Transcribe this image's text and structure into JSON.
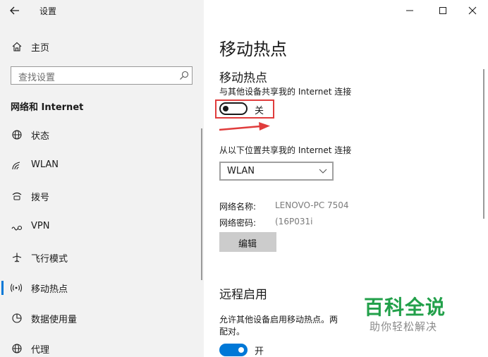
{
  "window": {
    "title": "设置",
    "back_icon": "back-arrow-icon",
    "controls": [
      "minimize-icon",
      "maximize-icon",
      "close-icon"
    ]
  },
  "sidebar": {
    "home_label": "主页",
    "search_placeholder": "查找设置",
    "section_title": "网络和 Internet",
    "items": [
      {
        "label": "状态",
        "icon": "globe-icon"
      },
      {
        "label": "WLAN",
        "icon": "wifi-icon"
      },
      {
        "label": "拨号",
        "icon": "dialup-icon"
      },
      {
        "label": "VPN",
        "icon": "vpn-icon"
      },
      {
        "label": "飞行模式",
        "icon": "airplane-icon"
      },
      {
        "label": "移动热点",
        "icon": "hotspot-icon",
        "selected": true
      },
      {
        "label": "数据使用量",
        "icon": "data-usage-icon"
      },
      {
        "label": "代理",
        "icon": "proxy-globe-icon"
      }
    ]
  },
  "main": {
    "page_title": "移动热点",
    "hotspot": {
      "heading": "移动热点",
      "description": "与其他设备共享我的 Internet 连接",
      "toggle_state": "关",
      "toggle_on": false
    },
    "share_from": {
      "label": "从以下位置共享我的 Internet 连接",
      "selected": "WLAN"
    },
    "network_name": {
      "label": "网络名称:",
      "value": "LENOVO-PC 7504"
    },
    "network_password": {
      "label": "网络密码:",
      "value": "(16P031i"
    },
    "edit_button": "编辑",
    "remote": {
      "heading": "远程启用",
      "description_line1": "允许其他设备启用移动热点。两",
      "description_line2": "配对。",
      "toggle_state": "开",
      "toggle_on": true
    }
  },
  "watermark": {
    "title": "百科全说",
    "subtitle": "助你轻松解决"
  },
  "colors": {
    "accent": "#0078d7",
    "annotation_red": "#e03c3c",
    "watermark_green": "#22a04a",
    "sidebar_bg": "#f2f2f2"
  }
}
